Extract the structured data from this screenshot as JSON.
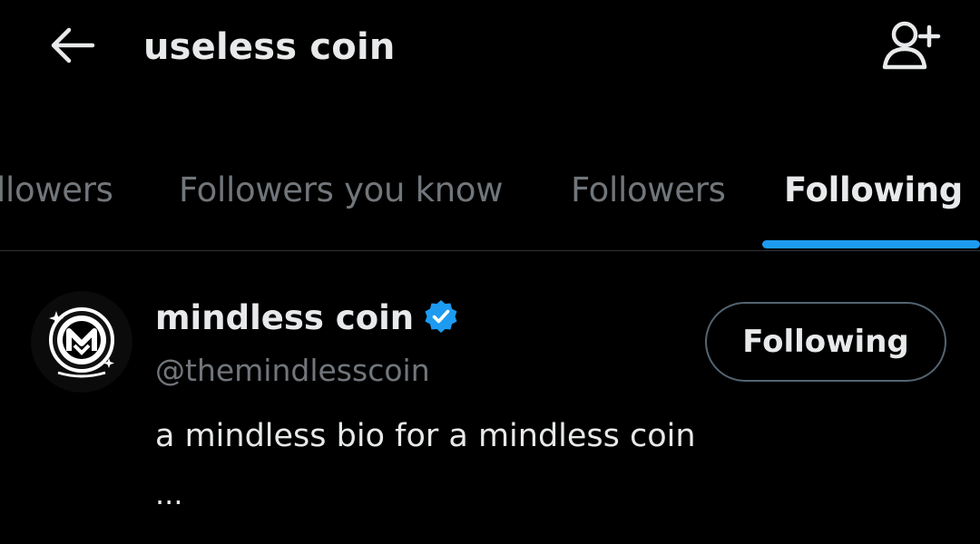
{
  "header": {
    "title": "useless coin",
    "back_icon": "arrow-left-icon",
    "add_user_icon": "add-user-icon"
  },
  "tabs": [
    {
      "label": "Verified Followers",
      "visible_label": "llowers",
      "active": false
    },
    {
      "label": "Followers you know",
      "active": false
    },
    {
      "label": "Followers",
      "active": false
    },
    {
      "label": "Following",
      "active": true
    }
  ],
  "users": [
    {
      "display_name": "mindless coin",
      "verified": true,
      "handle": "@themindlesscoin",
      "bio": "a mindless bio for a mindless coin",
      "more": "...",
      "button_label": "Following"
    }
  ],
  "colors": {
    "background": "#000000",
    "text_primary": "#e7e9ea",
    "text_secondary": "#71767b",
    "accent": "#1d9bf0",
    "border": "#2f3336"
  }
}
